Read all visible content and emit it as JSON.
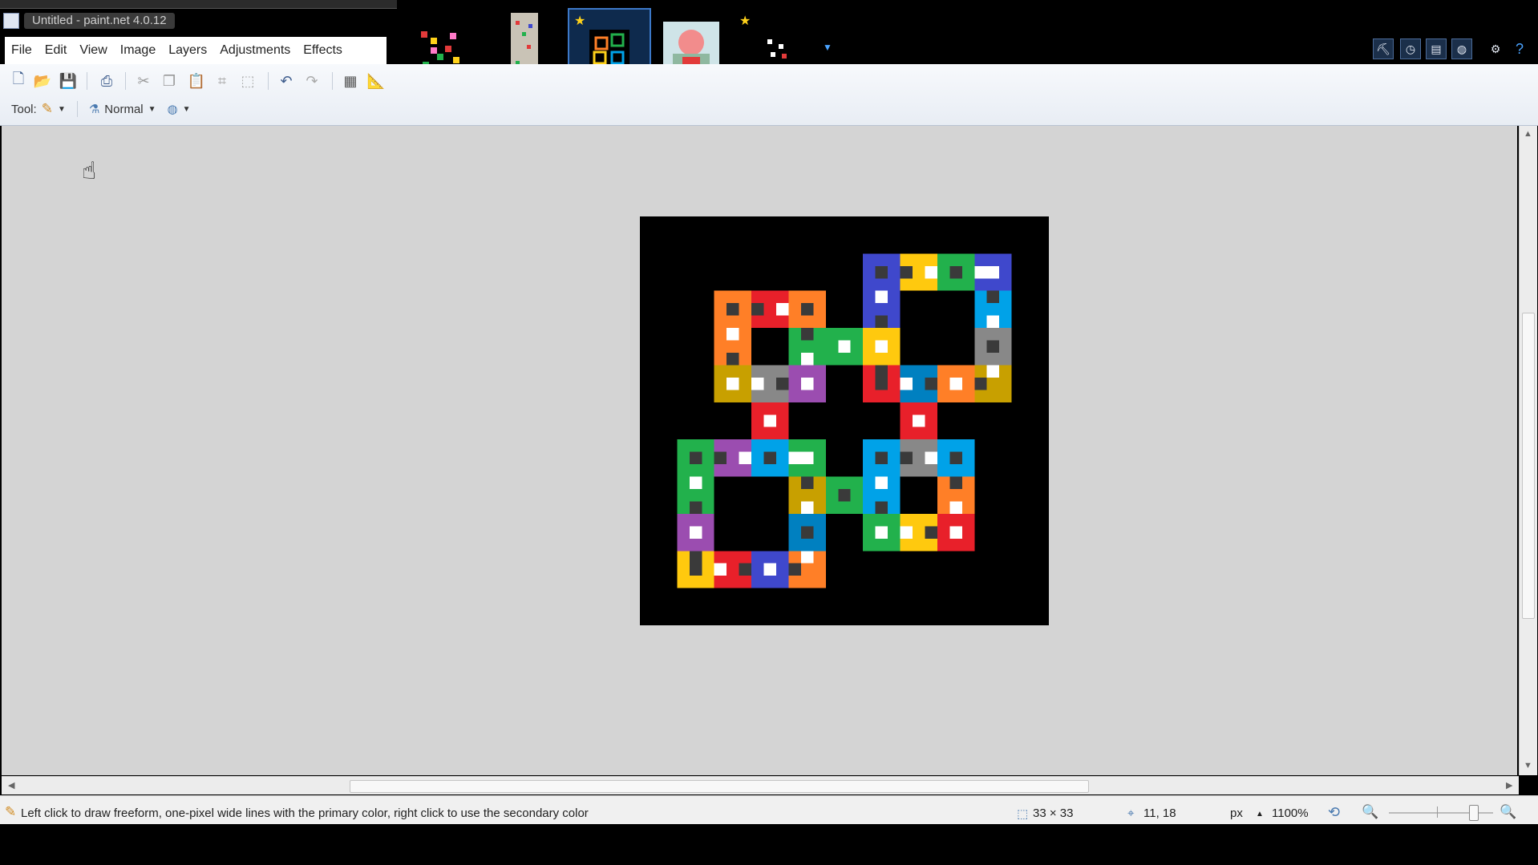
{
  "window": {
    "title": "Untitled - paint.net 4.0.12"
  },
  "menu": [
    "File",
    "Edit",
    "View",
    "Image",
    "Layers",
    "Adjustments",
    "Effects"
  ],
  "image_tabs": [
    {
      "name": "image-tab-1",
      "active": false,
      "unsaved": false
    },
    {
      "name": "image-tab-2",
      "active": false,
      "unsaved": false
    },
    {
      "name": "image-tab-3",
      "active": true,
      "unsaved": true
    },
    {
      "name": "image-tab-4",
      "active": false,
      "unsaved": true
    },
    {
      "name": "image-tab-5",
      "active": false,
      "unsaved": false
    }
  ],
  "toolbar": {
    "tool_label": "Tool:",
    "blend_mode": "Normal"
  },
  "status": {
    "hint": "Left click to draw freeform, one-pixel wide lines with the primary color, right click to use the secondary color",
    "image_size": "33 × 33",
    "cursor_pos": "11, 18",
    "units": "px",
    "zoom": "1100%"
  },
  "colors": {
    "accent": "#3c78c8",
    "workspace": "#d4d4d4"
  }
}
